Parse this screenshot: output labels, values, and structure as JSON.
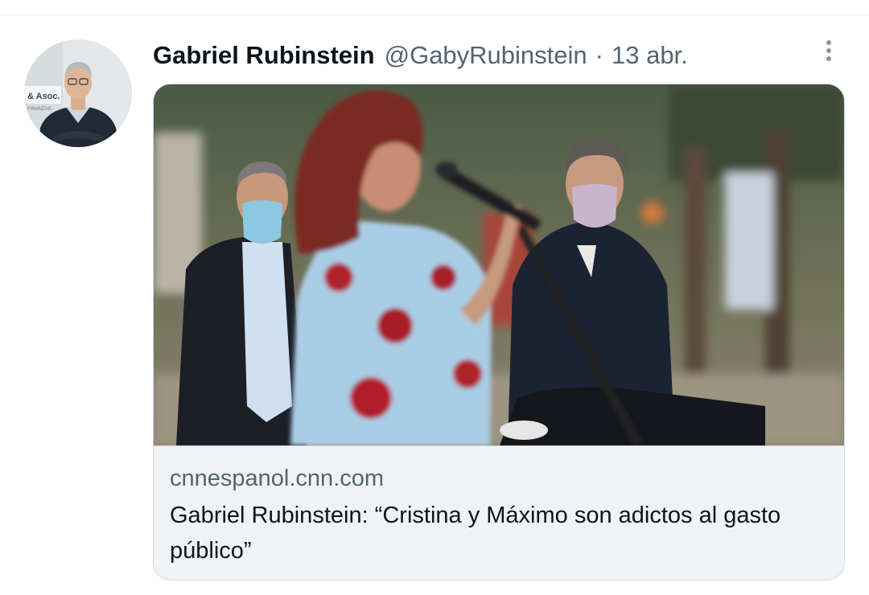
{
  "tweet": {
    "author": {
      "display_name": "Gabriel Rubinstein",
      "handle": "@GabyRubinstein",
      "avatar_sign_text": "& Asoc.",
      "avatar_sign_subtext": "FINANZAS"
    },
    "separator": "·",
    "timestamp": "13 abr.",
    "more_icon": "more-vertical-icon"
  },
  "card": {
    "domain": "cnnespanol.cnn.com",
    "title": "Gabriel Rubinstein: “Cristina y Máximo son adictos al gasto público”"
  }
}
